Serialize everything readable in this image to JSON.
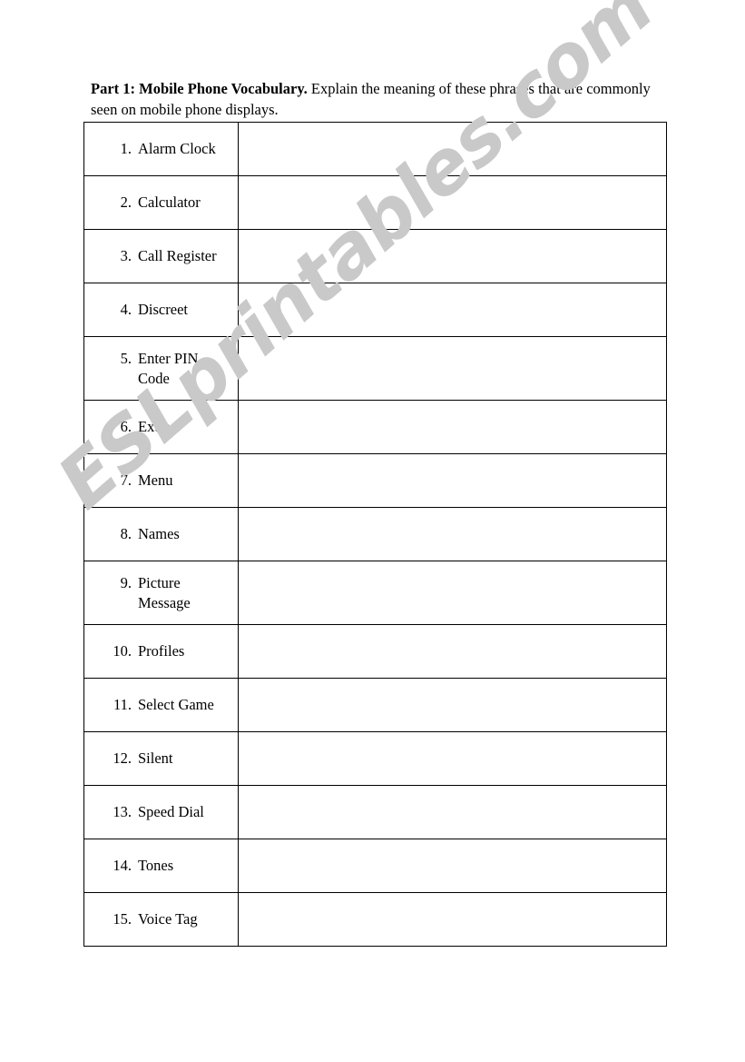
{
  "document": {
    "intro": {
      "lead": "Part 1:  Mobile Phone Vocabulary.",
      "rest": " Explain the meaning of these phrases that are commonly seen on mobile phone displays."
    },
    "watermark": {
      "text": "ESLprintables.com",
      "color": "#c9c9c9"
    },
    "table": {
      "rows": [
        {
          "num": "1.",
          "term": "Alarm Clock",
          "answer": "",
          "two_line": false
        },
        {
          "num": "2.",
          "term": "Calculator",
          "answer": "",
          "two_line": false
        },
        {
          "num": "3.",
          "term": "Call Register",
          "answer": "",
          "two_line": false
        },
        {
          "num": "4.",
          "term": "Discreet",
          "answer": "",
          "two_line": false
        },
        {
          "num": "5.",
          "term": "Enter PIN Code",
          "answer": "",
          "two_line": true
        },
        {
          "num": "6.",
          "term": "Extras",
          "answer": "",
          "two_line": false
        },
        {
          "num": "7.",
          "term": "Menu",
          "answer": "",
          "two_line": false
        },
        {
          "num": "8.",
          "term": "Names",
          "answer": "",
          "two_line": false
        },
        {
          "num": "9.",
          "term": "Picture Message",
          "answer": "",
          "two_line": true
        },
        {
          "num": "10.",
          "term": "Profiles",
          "answer": "",
          "two_line": false
        },
        {
          "num": "11.",
          "term": "Select Game",
          "answer": "",
          "two_line": false
        },
        {
          "num": "12.",
          "term": "Silent",
          "answer": "",
          "two_line": false
        },
        {
          "num": "13.",
          "term": "Speed Dial",
          "answer": "",
          "two_line": false
        },
        {
          "num": "14.",
          "term": "Tones",
          "answer": "",
          "two_line": false
        },
        {
          "num": "15.",
          "term": "Voice Tag",
          "answer": "",
          "two_line": false
        }
      ]
    }
  }
}
